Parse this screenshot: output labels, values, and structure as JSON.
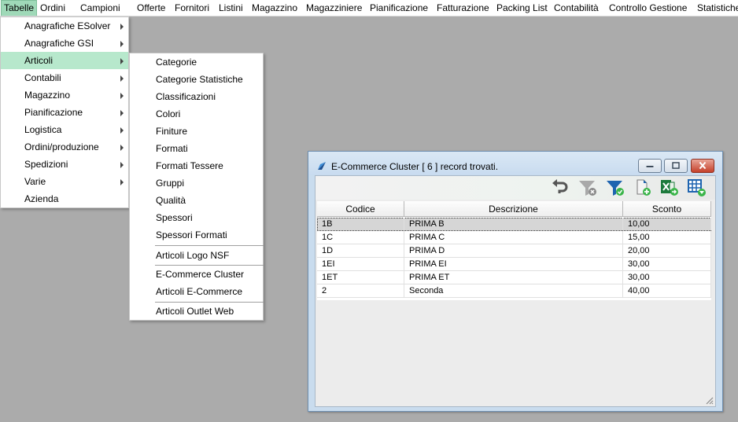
{
  "menubar": {
    "items": [
      "Tabelle",
      "Ordini",
      "Campioni",
      "Offerte",
      "Fornitori",
      "Listini",
      "Magazzino",
      "Magazziniere",
      "Pianificazione",
      "Fatturazione",
      "Packing List",
      "Contabilità",
      "Controllo Gestione",
      "Statistiche"
    ]
  },
  "menu_level1": {
    "items": [
      "Anagrafiche ESolver",
      "Anagrafiche GSI",
      "Articoli",
      "Contabili",
      "Magazzino",
      "Pianificazione",
      "Logistica",
      "Ordini/produzione",
      "Spedizioni",
      "Varie",
      "Azienda"
    ],
    "highlighted": "Articoli"
  },
  "menu_level2": {
    "items": [
      "Categorie",
      "Categorie Statistiche",
      "Classificazioni",
      "Colori",
      "Finiture",
      "Formati",
      "Formati Tessere",
      "Gruppi",
      "Qualità",
      "Spessori",
      "Spessori Formati",
      "Articoli Logo NSF",
      "E-Commerce Cluster",
      "Articoli E-Commerce",
      "Articoli Outlet Web"
    ]
  },
  "window": {
    "title": "E-Commerce Cluster   [ 6 ] record trovati.",
    "toolbar_icons": [
      "undo-icon",
      "filter-clear-icon",
      "filter-apply-icon",
      "new-record-icon",
      "excel-export-icon",
      "grid-settings-icon"
    ],
    "columns": [
      "Codice",
      "Descrizione",
      "Sconto"
    ],
    "rows": [
      [
        "1B",
        "PRIMA B",
        "10,00"
      ],
      [
        "1C",
        "PRIMA C",
        "15,00"
      ],
      [
        "1D",
        "PRIMA D",
        "20,00"
      ],
      [
        "1EI",
        "PRIMA EI",
        "30,00"
      ],
      [
        "1ET",
        "PRIMA ET",
        "30,00"
      ],
      [
        "2",
        "Seconda",
        "40,00"
      ]
    ],
    "selected_row": 0
  },
  "colors": {
    "desktop": "#ababab",
    "menu_highlight": "#b7e8cc",
    "menubar_active": "#9fd9b8",
    "window_frame": "#c9dcee",
    "close_button": "#c4402a"
  }
}
